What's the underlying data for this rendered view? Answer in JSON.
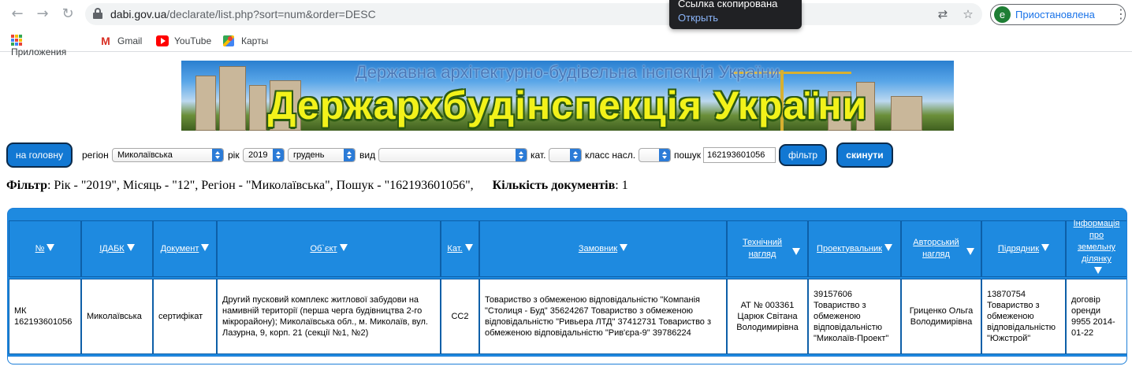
{
  "browser": {
    "url_host": "dabi.gov.ua",
    "url_path": "/declarate/list.php?sort=num&order=DESC",
    "profile_initial": "e",
    "profile_label": "Приостановлена",
    "toast_title": "Ссылка скопирована",
    "toast_action": "Открыть"
  },
  "bookmarks": [
    {
      "label": "Приложения",
      "icon": "apps-grid-icon"
    },
    {
      "label": "Gmail",
      "icon": "gmail-icon"
    },
    {
      "label": "YouTube",
      "icon": "youtube-icon"
    },
    {
      "label": "Карты",
      "icon": "maps-icon"
    }
  ],
  "banner": {
    "subtitle": "Державна архітектурно-будівельна інспекція України",
    "title": "Держархбудінспекція України"
  },
  "filters": {
    "home_button": "на головну",
    "region_label": "регіон",
    "region_value": "Миколаївська",
    "year_label": "рік",
    "year_value": "2019",
    "month_value": "грудень",
    "type_label": "вид",
    "type_value": "",
    "category_label": "кат.",
    "category_value": "",
    "class_label": "класс насл.",
    "class_value": "",
    "search_label": "пошук",
    "search_value": "162193601056",
    "filter_button": "фільтр",
    "reset_button": "скинути"
  },
  "summary": {
    "filter_label": "Фільтр",
    "filter_text": ": Рік - \"2019\", Місяць - \"12\", Регіон - \"Миколаївська\", Пошук - \"162193601056\",",
    "count_label": "Кількість документів",
    "count_value": ": 1"
  },
  "table": {
    "columns": [
      {
        "key": "num",
        "label": "№"
      },
      {
        "key": "idabk",
        "label": "ІДАБК"
      },
      {
        "key": "doc",
        "label": "Документ"
      },
      {
        "key": "object",
        "label": "Об`єкт"
      },
      {
        "key": "cat",
        "label": "Кат."
      },
      {
        "key": "customer",
        "label": "Замовник"
      },
      {
        "key": "tech",
        "label": "Технічний нагляд"
      },
      {
        "key": "designer",
        "label": "Проектувальник"
      },
      {
        "key": "author",
        "label": "Авторський нагляд"
      },
      {
        "key": "contractor",
        "label": "Підрядник"
      },
      {
        "key": "land",
        "label": "Інформація про земельну ділянку"
      }
    ],
    "rows": [
      {
        "num": "МК 162193601056",
        "idabk": "Миколаївська",
        "doc": "сертифікат",
        "object": "Другий пусковий комплекс житлової забудови на намивній території (перша черга будівництва 2-го мікрорайону); Миколаївська обл., м. Миколаїв, вул. Лазурна, 9, корп. 21 (секції №1, №2)",
        "cat": "СС2",
        "customer": "Товариство з обмеженою відповідальністю \"Компанія \"Столиця - Буд\" 35624267 Товариство з обмеженою відповідальністю \"Ривьера ЛТД\" 37412731 Товариство з обмеженою відповідальністю \"Рив'єра-9\" 39786224",
        "tech": "АТ № 003361 Царюк Світана Володимирівна",
        "designer": "39157606 Товариство з обмеженою відповідальністю \"Миколаїв-Проект\"",
        "author": "Гриценко Ольга Володимирівна",
        "contractor": "13870754 Товариство з обмеженою відповідальністю \"Южстрой\"",
        "land": "договір оренди 9955 2014-01-22"
      }
    ]
  },
  "colors": {
    "header_blue": "#1e8ae0",
    "button_blue": "#1278d3",
    "banner_title_yellow": "#f2f21a"
  }
}
